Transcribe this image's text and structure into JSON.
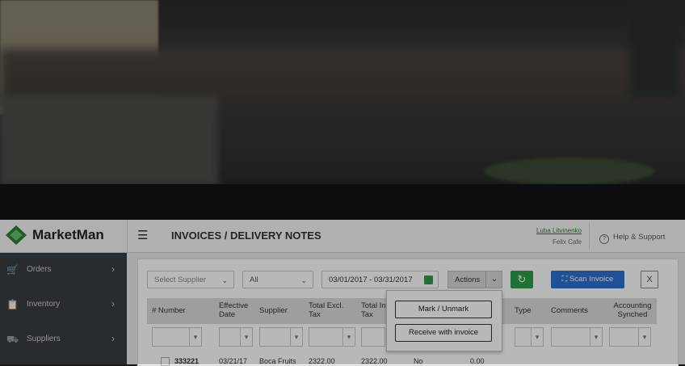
{
  "app": {
    "name": "MarketMan"
  },
  "header": {
    "title": "INVOICES / DELIVERY NOTES",
    "user_name": "Luba Litvinenko",
    "venue": "Felix Cafe",
    "help_label": "Help & Support"
  },
  "sidebar": {
    "items": [
      {
        "label": "Orders",
        "icon": "cart-icon"
      },
      {
        "label": "Inventory",
        "icon": "clipboard-icon"
      },
      {
        "label": "Suppliers",
        "icon": "truck-icon"
      }
    ]
  },
  "toolbar": {
    "supplier_placeholder": "Select Supplier",
    "status_value": "All",
    "date_range": "03/01/2017 - 03/31/2017",
    "actions_label": "Actions",
    "scan_label": "Scan Invoice"
  },
  "actions_menu": {
    "mark_label": "Mark / Unmark",
    "receive_label": "Receive with invoice"
  },
  "table": {
    "headers": {
      "number": "# Number",
      "effective_date": "Effective Date",
      "supplier": "Supplier",
      "total_excl_tax": "Total Excl. Tax",
      "total_incl_tax": "Total Incl. Tax",
      "type": "Type",
      "comments": "Comments",
      "accounting_synched": "Accounting Synched"
    },
    "rows": [
      {
        "number": "333221",
        "date": "03/21/17",
        "supplier": "Boca Fruits",
        "total_excl": "2322.00",
        "total_incl": "2322.00",
        "flag": "No",
        "extra": "0.00"
      }
    ]
  },
  "colors": {
    "accent_green": "#2e9b4a",
    "scan_blue": "#2f6fcf",
    "sidebar": "#3a3d42"
  }
}
